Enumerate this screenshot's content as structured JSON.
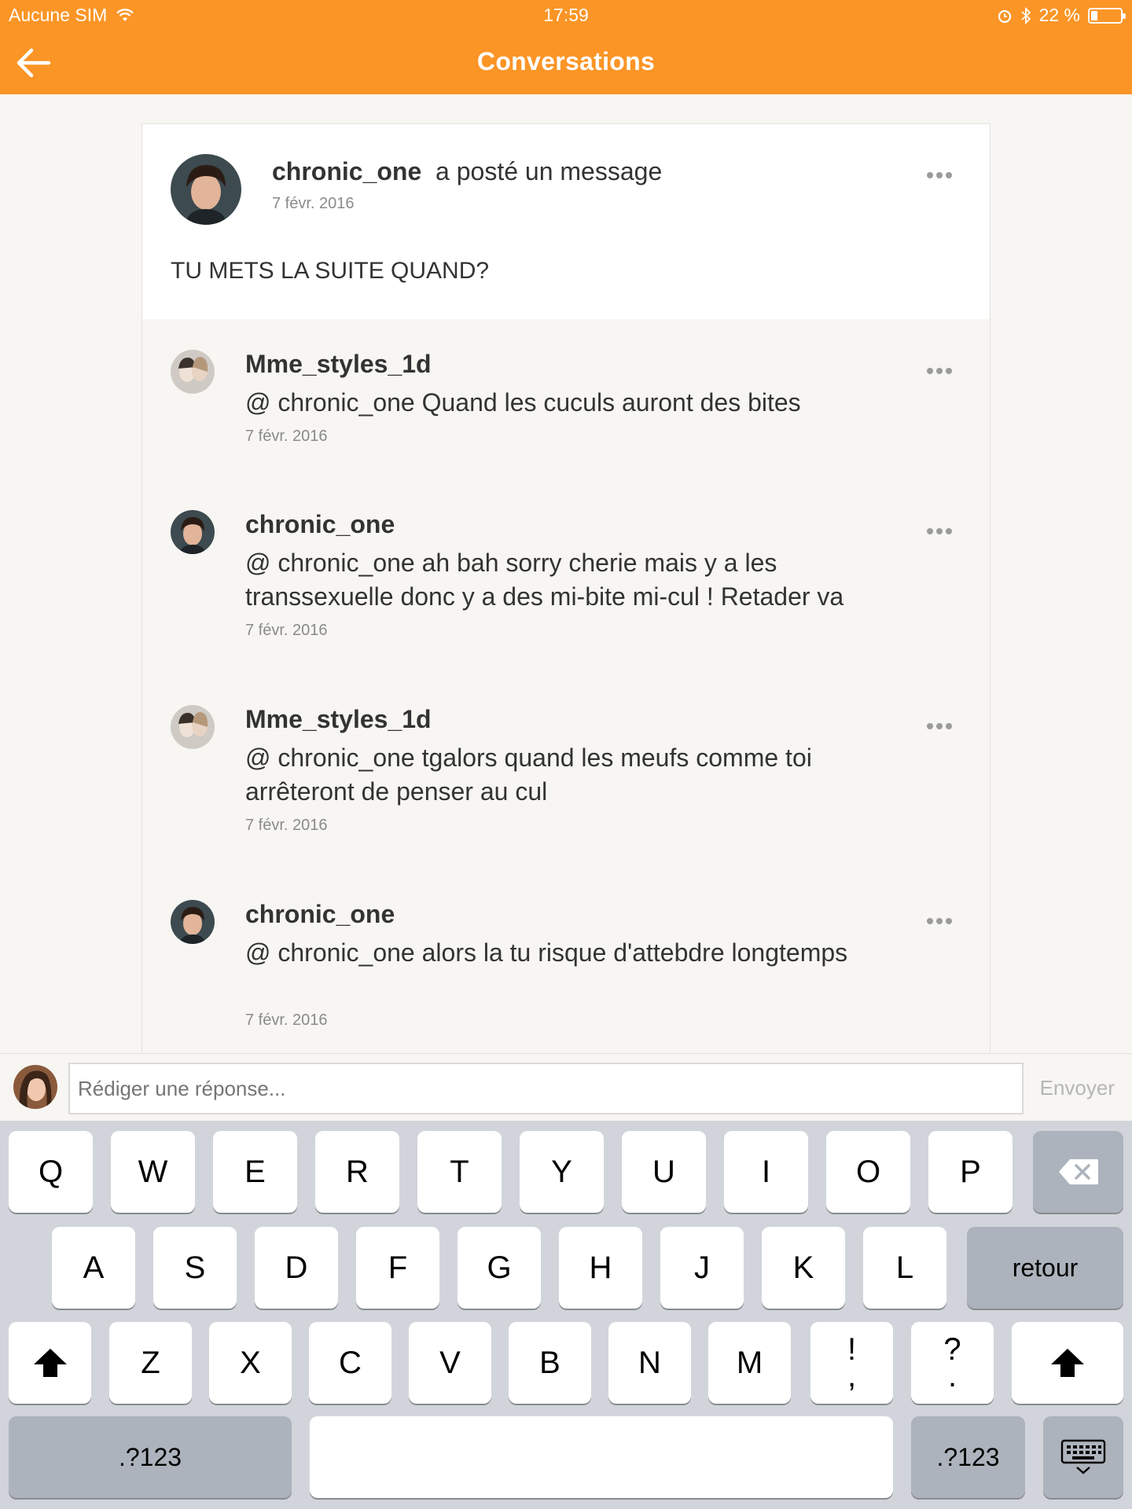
{
  "status_bar": {
    "carrier": "Aucune SIM",
    "time": "17:59",
    "battery": "22 %",
    "battery_level": 0.22
  },
  "nav": {
    "title": "Conversations"
  },
  "post": {
    "author": "chronic_one",
    "action": "a posté un message",
    "date": "7 févr. 2016",
    "message": "TU METS LA SUITE QUAND?"
  },
  "replies": [
    {
      "author": "Mme_styles_1d",
      "text": "@ chronic_one  Quand les cuculs auront des bites",
      "date": "7 févr. 2016"
    },
    {
      "author": "chronic_one",
      "text": "@ chronic_one  ah bah sorry cherie mais y a les transsexuelle donc y a des mi-bite mi-cul ! Retader va",
      "date": "7 févr. 2016"
    },
    {
      "author": "Mme_styles_1d",
      "text": "@ chronic_one  tgalors quand les meufs comme toi arrêteront de penser au cul",
      "date": "7 févr. 2016"
    },
    {
      "author": "chronic_one",
      "text": "@ chronic_one  alors la tu risque d'attebdre longtemps",
      "date": "7 févr. 2016"
    }
  ],
  "compose": {
    "placeholder": "Rédiger une réponse...",
    "send_label": "Envoyer"
  },
  "keyboard": {
    "row1": [
      "Q",
      "W",
      "E",
      "R",
      "T",
      "Y",
      "U",
      "I",
      "O",
      "P"
    ],
    "row2": [
      "A",
      "S",
      "D",
      "F",
      "G",
      "H",
      "J",
      "K",
      "L"
    ],
    "return_label": "retour",
    "row3": [
      "Z",
      "X",
      "C",
      "V",
      "B",
      "N",
      "M"
    ],
    "excl_top": "!",
    "excl_bottom": ",",
    "quest_top": "?",
    "quest_bottom": ".",
    "numbers_label": ".?123"
  },
  "colors": {
    "accent": "#fb9526",
    "background": "#f7f6f2"
  }
}
